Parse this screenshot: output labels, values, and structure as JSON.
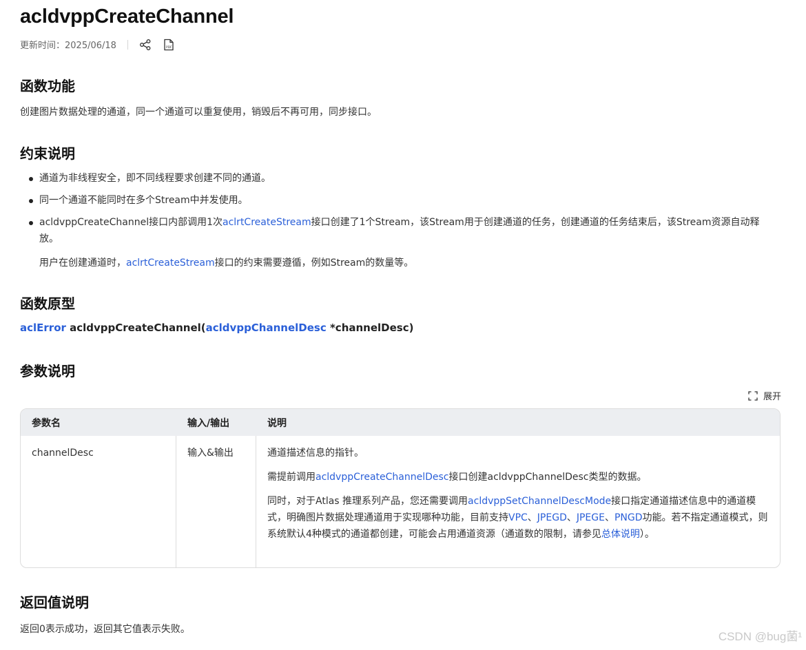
{
  "title": "acldvppCreateChannel",
  "meta": {
    "updated": "更新时间：2025/06/18",
    "share_icon": "share-icon",
    "pdf_icon": "pdf-icon"
  },
  "sections": {
    "func": {
      "heading": "函数功能",
      "text": "创建图片数据处理的通道，同一个通道可以重复使用，销毁后不再可用，同步接口。"
    },
    "constraint": {
      "heading": "约束说明",
      "items": [
        "通道为非线程安全，即不同线程要求创建不同的通道。",
        "同一个通道不能同时在多个Stream中并发使用。"
      ],
      "item3_pre": "acldvppCreateChannel接口内部调用1次",
      "item3_link": "aclrtCreateStream",
      "item3_post": "接口创建了1个Stream，该Stream用于创建通道的任务，创建通道的任务结束后，该Stream资源自动释放。",
      "note_pre": "用户在创建通道时，",
      "note_link": "aclrtCreateStream",
      "note_post": "接口的约束需要遵循，例如Stream的数量等。"
    },
    "proto": {
      "heading": "函数原型",
      "ret_type": "aclError",
      "fn_name": " acldvppCreateChannel(",
      "param_type": "acldvppChannelDesc",
      "param_rest": " *channelDesc)"
    },
    "params": {
      "heading": "参数说明",
      "expand_label": "展开",
      "headers": [
        "参数名",
        "输入/输出",
        "说明"
      ],
      "row": {
        "name": "channelDesc",
        "io": "输入&输出",
        "d1": "通道描述信息的指针。",
        "d2_pre": "需提前调用",
        "d2_link": "acldvppCreateChannelDesc",
        "d2_post": "接口创建acldvppChannelDesc类型的数据。",
        "d3_pre": "同时，对于Atlas 推理系列产品，您还需要调用",
        "d3_link1": "acldvppSetChannelDescMode",
        "d3_mid1": "接口指定通道描述信息中的通道模式，明确图片数据处理通道用于实现哪种功能，目前支持",
        "d3_vpc": "VPC",
        "d3_sep1": "、",
        "d3_jpegd": "JPEGD",
        "d3_sep2": "、",
        "d3_jpege": "JPEGE",
        "d3_sep3": "、",
        "d3_pngd": "PNGD",
        "d3_mid2": "功能。若不指定通道模式，则系统默认4种模式的通道都创建，可能会占用通道资源（通道数的限制，请参见",
        "d3_link2": "总体说明",
        "d3_end": "）。"
      }
    },
    "ret": {
      "heading": "返回值说明",
      "text": "返回0表示成功，返回其它值表示失败。"
    }
  },
  "watermark": "CSDN @bug菌¹"
}
